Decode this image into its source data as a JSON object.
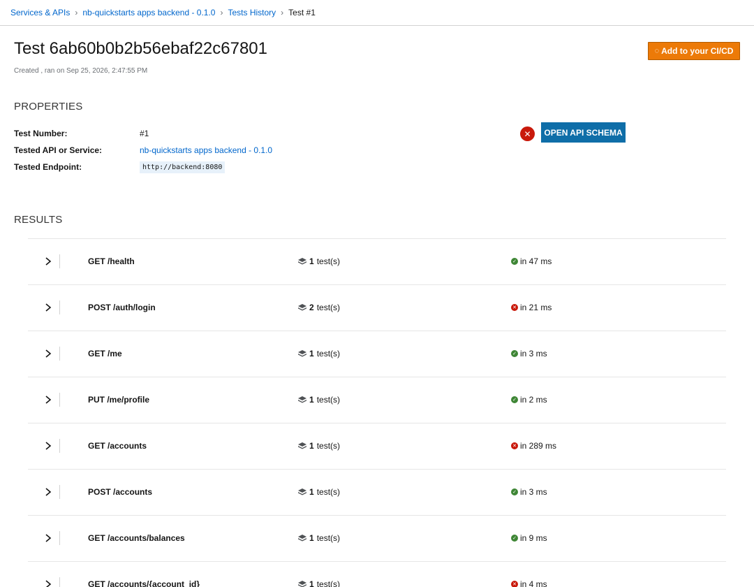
{
  "breadcrumb": {
    "items": [
      "Services & APIs",
      "nb-quickstarts apps backend - 0.1.0",
      "Tests History"
    ],
    "current": "Test #1"
  },
  "header": {
    "title": "Test 6ab60b0b2b56ebaf22c67801",
    "subtitle": "Created , ran on Sep 25, 2026, 2:47:55 PM",
    "cicd_button": "Add to your CI/CD",
    "cicd_icon": "spinner-icon"
  },
  "properties": {
    "section_title": "PROPERTIES",
    "test_number_label": "Test Number:",
    "test_number": "#1",
    "tested_api_label": "Tested API or Service:",
    "tested_api": "nb-quickstarts apps backend - 0.1.0",
    "tested_endpoint_label": "Tested Endpoint:",
    "tested_endpoint": "http://backend:8080",
    "overall_status": "fail",
    "schema_button": "OPEN API SCHEMA"
  },
  "results": {
    "section_title": "RESULTS",
    "tests_suffix": "test(s)",
    "colors": {
      "success": "#3e8635",
      "failure": "#c9190b"
    },
    "rows": [
      {
        "operation": "GET /health",
        "count": "1",
        "status": "ok",
        "duration": "in 47 ms"
      },
      {
        "operation": "POST /auth/login",
        "count": "2",
        "status": "fail",
        "duration": "in 21 ms"
      },
      {
        "operation": "GET /me",
        "count": "1",
        "status": "ok",
        "duration": "in 3 ms"
      },
      {
        "operation": "PUT /me/profile",
        "count": "1",
        "status": "ok",
        "duration": "in 2 ms"
      },
      {
        "operation": "GET /accounts",
        "count": "1",
        "status": "fail",
        "duration": "in 289 ms"
      },
      {
        "operation": "POST /accounts",
        "count": "1",
        "status": "ok",
        "duration": "in 3 ms"
      },
      {
        "operation": "GET /accounts/balances",
        "count": "1",
        "status": "ok",
        "duration": "in 9 ms"
      },
      {
        "operation": "GET /accounts/{account_id}",
        "count": "1",
        "status": "fail",
        "duration": "in 4 ms"
      }
    ]
  }
}
